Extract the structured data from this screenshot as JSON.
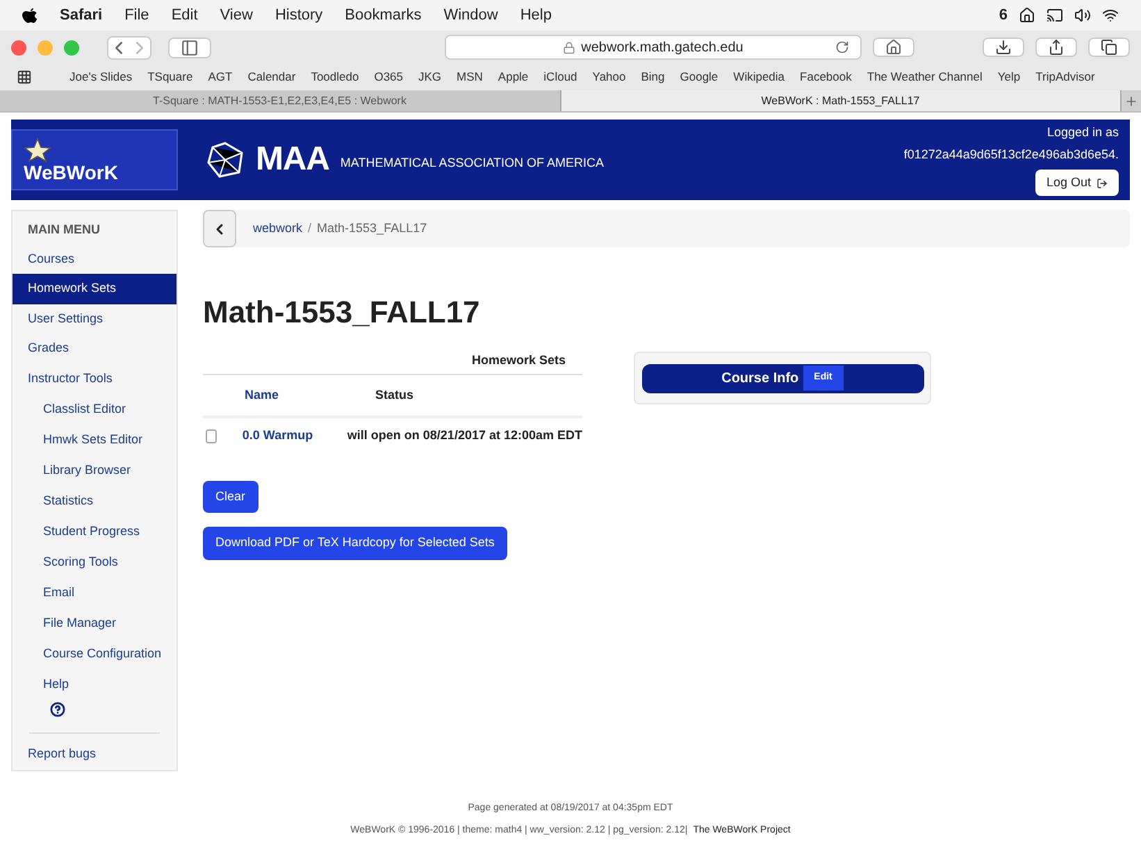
{
  "menu_bar": {
    "app": "Safari",
    "items": [
      "File",
      "Edit",
      "View",
      "History",
      "Bookmarks",
      "Window",
      "Help"
    ],
    "status_count": "6"
  },
  "toolbar": {
    "address": "webwork.math.gatech.edu"
  },
  "bookmarks": [
    "Joe's Slides",
    "TSquare",
    "AGT",
    "Calendar",
    "Toodledo",
    "O365",
    "JKG",
    "MSN",
    "Apple",
    "iCloud",
    "Yahoo",
    "Bing",
    "Google",
    "Wikipedia",
    "Facebook",
    "The Weather Channel",
    "Yelp",
    "TripAdvisor"
  ],
  "tabs": [
    {
      "label": "T-Square : MATH-1553-E1,E2,E3,E4,E5 : Webwork",
      "selected": false
    },
    {
      "label": "WeBWorK : Math-1553_FALL17",
      "selected": true
    }
  ],
  "header": {
    "logo": "WeBWorK",
    "maa": "MAA",
    "maa_full": "MATHEMATICAL ASSOCIATION OF AMERICA",
    "logged_in": "Logged in as",
    "user": "f01272a44a9d65f13cf2e496ab3d6e54.",
    "logout": "Log Out"
  },
  "sidebar": {
    "heading": "MAIN MENU",
    "items": [
      {
        "label": "Courses",
        "selected": false
      },
      {
        "label": "Homework Sets",
        "selected": true
      },
      {
        "label": "User Settings",
        "selected": false
      },
      {
        "label": "Grades",
        "selected": false
      },
      {
        "label": "Instructor Tools",
        "selected": false,
        "children": [
          {
            "label": "Classlist Editor"
          },
          {
            "label": "Hmwk Sets Editor"
          },
          {
            "label": "Library Browser"
          },
          {
            "label": "Statistics"
          },
          {
            "label": "Student Progress"
          },
          {
            "label": "Scoring Tools"
          },
          {
            "label": "Email"
          },
          {
            "label": "File Manager"
          },
          {
            "label": "Course Configuration"
          },
          {
            "label": "Help"
          }
        ]
      }
    ],
    "report": "Report bugs"
  },
  "breadcrumb": [
    "webwork",
    "/",
    "Math-1553_FALL17"
  ],
  "title": "Math-1553_FALL17",
  "table": {
    "caption": "Homework Sets",
    "columns": [
      "Name",
      "Status"
    ],
    "rows": [
      {
        "name": "0.0 Warmup",
        "status": "will open on 08/21/2017 at 12:00am EDT",
        "checked": false
      }
    ]
  },
  "buttons": [
    "Clear",
    "Download PDF or TeX Hardcopy for Selected Sets"
  ],
  "course_info": {
    "title": "Course Info",
    "edit": "Edit"
  },
  "footer": {
    "generated": "Page generated at 08/19/2017 at 04:35pm EDT",
    "credits": "WeBWorK © 1996-2016 | theme: math4 | ww_version: 2.12 | pg_version: 2.12|",
    "project": "The WeBWorK Project"
  }
}
